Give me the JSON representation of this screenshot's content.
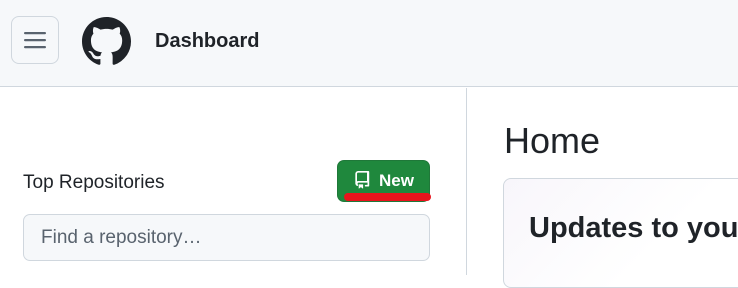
{
  "header": {
    "title": "Dashboard",
    "menu_icon": "hamburger-menu-icon",
    "logo_icon": "github-logo-icon"
  },
  "sidebar": {
    "heading": "Top Repositories",
    "new_button": {
      "label": "New",
      "icon": "repo-icon",
      "color": "#1f883d"
    },
    "search": {
      "placeholder": "Find a repository…",
      "value": ""
    }
  },
  "main": {
    "title": "Home",
    "card_title": "Updates to you"
  },
  "colors": {
    "header_bg": "#f6f8fa",
    "border": "#d0d7de",
    "primary_button": "#1f883d",
    "highlight": "#e8141c"
  }
}
